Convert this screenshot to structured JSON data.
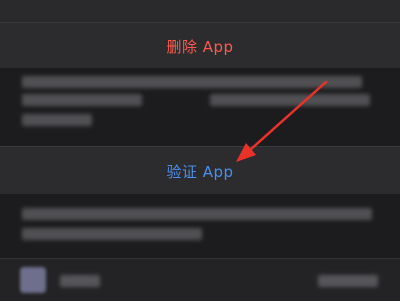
{
  "actions": {
    "delete_label": "删除 App",
    "verify_label": "验证 App"
  },
  "colors": {
    "background": "#1c1c1e",
    "row": "#2c2c2e",
    "delete": "#ff5a4f",
    "verify": "#4a8ff0",
    "annotation_arrow": "#e8322a"
  }
}
